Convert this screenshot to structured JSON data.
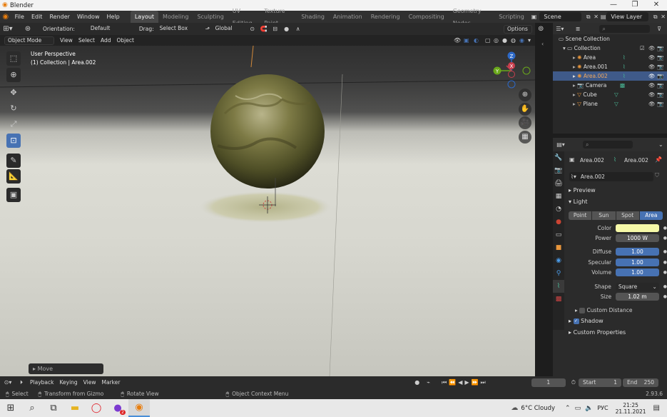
{
  "window": {
    "title": "Blender",
    "version": "2.93.6"
  },
  "menus": [
    "File",
    "Edit",
    "Render",
    "Window",
    "Help"
  ],
  "workspaces": [
    "Layout",
    "Modeling",
    "Sculpting",
    "UV Editing",
    "Texture Paint",
    "Shading",
    "Animation",
    "Rendering",
    "Compositing",
    "Geometry Nodes",
    "Scripting"
  ],
  "active_workspace": "Layout",
  "scene": {
    "name": "Scene",
    "view_layer": "View Layer"
  },
  "viewport_header": {
    "orientation_label": "Orientation:",
    "orientation_value": "Default",
    "drag_label": "Drag:",
    "drag_value": "Select Box",
    "transform_orientation": "Global",
    "options": "Options"
  },
  "viewport_header2": {
    "mode": "Object Mode",
    "items": [
      "View",
      "Select",
      "Add",
      "Object"
    ]
  },
  "viewport": {
    "perspective": "User Perspective",
    "collection_info": "(1) Collection | Area.002",
    "last_operator": "Move"
  },
  "gizmo": {
    "x": "X",
    "y": "Y",
    "z": "Z"
  },
  "outliner": {
    "root": "Scene Collection",
    "collection": "Collection",
    "items": [
      {
        "name": "Area",
        "selected": false
      },
      {
        "name": "Area.001",
        "selected": false
      },
      {
        "name": "Area.002",
        "selected": true
      },
      {
        "name": "Camera",
        "selected": false
      },
      {
        "name": "Cube",
        "selected": false
      },
      {
        "name": "Plane",
        "selected": false
      }
    ]
  },
  "properties": {
    "object_name": "Area.002",
    "data_name": "Area.002",
    "datablock": "Area.002",
    "panels": {
      "preview": "Preview",
      "light": "Light",
      "custom_distance": "Custom Distance",
      "shadow": "Shadow",
      "custom_properties": "Custom Properties"
    },
    "light_types": [
      "Point",
      "Sun",
      "Spot",
      "Area"
    ],
    "active_light_type": "Area",
    "color_label": "Color",
    "color_value": "#f6f9a8",
    "power_label": "Power",
    "power_value": "1000 W",
    "diffuse_label": "Diffuse",
    "diffuse_value": "1.00",
    "specular_label": "Specular",
    "specular_value": "1.00",
    "volume_label": "Volume",
    "volume_value": "1.00",
    "shape_label": "Shape",
    "shape_value": "Square",
    "size_label": "Size",
    "size_value": "1.02 m"
  },
  "timeline": {
    "menus": [
      "Playback",
      "Keying",
      "View",
      "Marker"
    ],
    "current_frame": "1",
    "start_label": "Start",
    "start": "1",
    "end_label": "End",
    "end": "250"
  },
  "statusbar": {
    "select": "Select",
    "transform": "Transform from Gizmo",
    "rotate": "Rotate View",
    "context_menu": "Object Context Menu"
  },
  "taskbar": {
    "weather": "6°C  Cloudy",
    "lang": "РУС",
    "time": "21:25",
    "date": "21.11.2021",
    "notification_count": "2"
  }
}
